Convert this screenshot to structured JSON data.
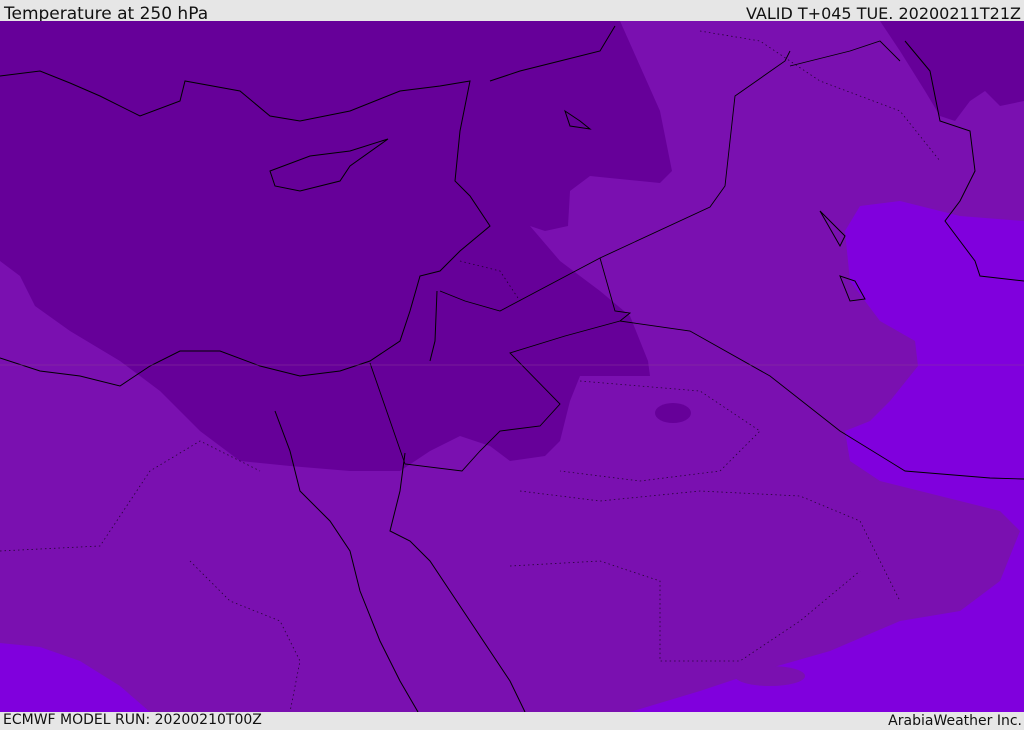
{
  "header": {
    "title": "Temperature at 250 hPa",
    "valid": "VALID T+045 TUE. 20200211T21Z"
  },
  "footer": {
    "model_run": "ECMWF MODEL RUN: 20200210T00Z",
    "credit": "ArabiaWeather Inc."
  },
  "colors": {
    "cold": "#660099",
    "mid": "#7a10b0",
    "warm": "#8000dd",
    "coast": "#000000",
    "background": "#e6e6e6"
  }
}
